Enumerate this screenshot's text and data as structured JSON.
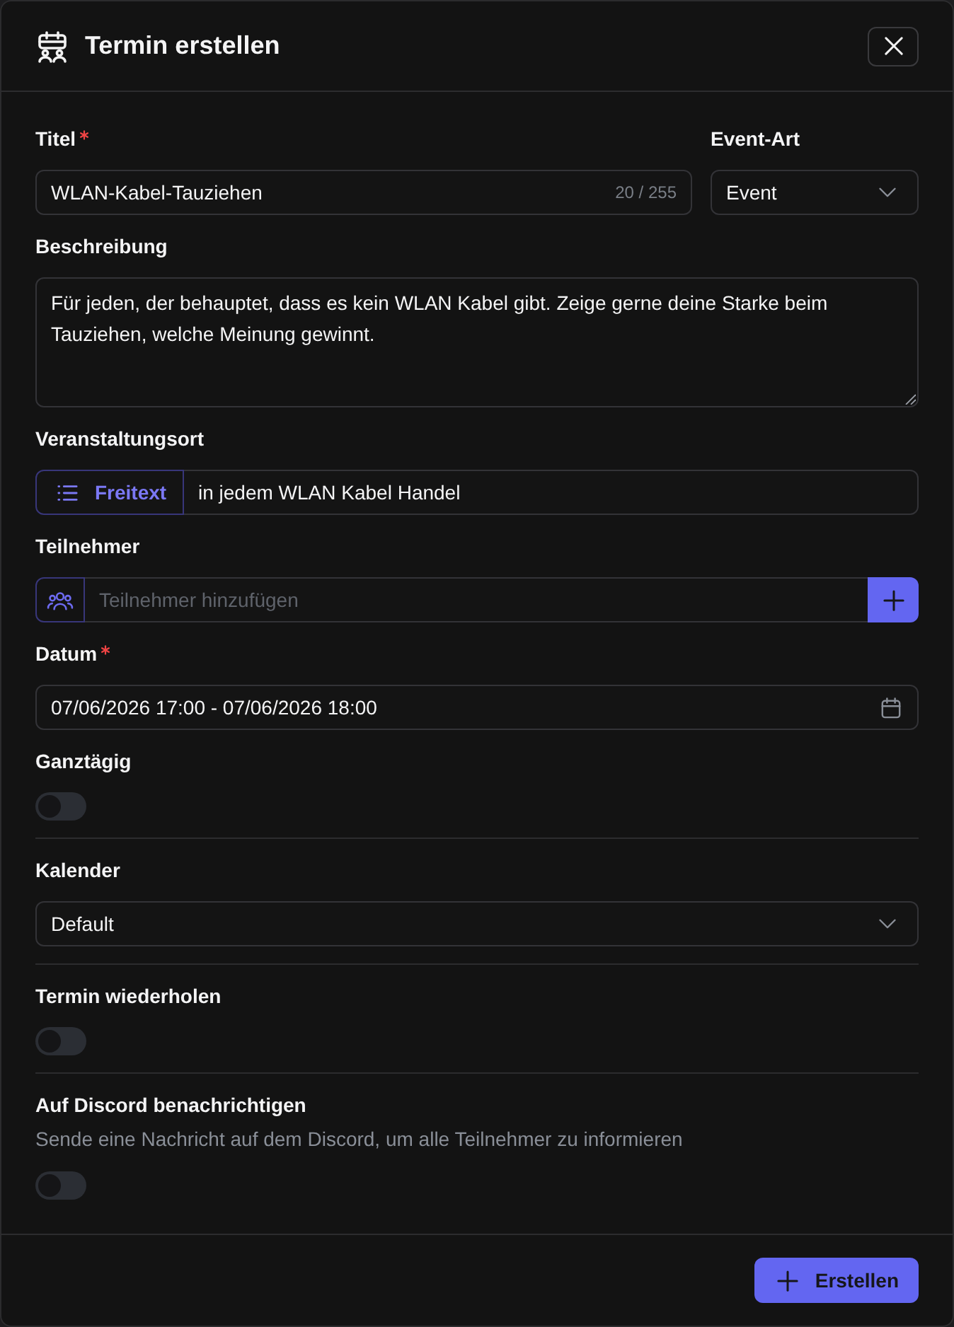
{
  "dialog": {
    "title": "Termin erstellen"
  },
  "title_field": {
    "label": "Titel",
    "required": true,
    "value": "WLAN-Kabel-Tauziehen",
    "counter": "20 / 255"
  },
  "event_type": {
    "label": "Event-Art",
    "value": "Event"
  },
  "description": {
    "label": "Beschreibung",
    "value": "Für jeden, der behauptet, dass es kein WLAN Kabel gibt. Zeige gerne deine Starke beim Tauziehen, welche Meinung gewinnt."
  },
  "location": {
    "label": "Veranstaltungsort",
    "mode": "Freitext",
    "value": "in jedem WLAN Kabel Handel"
  },
  "participants": {
    "label": "Teilnehmer",
    "placeholder": "Teilnehmer hinzufügen"
  },
  "date": {
    "label": "Datum",
    "required": true,
    "value": "07/06/2026 17:00 - 07/06/2026 18:00"
  },
  "all_day": {
    "label": "Ganztägig",
    "on": false
  },
  "calendar": {
    "label": "Kalender",
    "value": "Default"
  },
  "repeat": {
    "label": "Termin wiederholen",
    "on": false
  },
  "discord": {
    "label": "Auf Discord benachrichtigen",
    "hint": "Sende eine Nachricht auf dem Discord, um alle Teilnehmer zu informieren",
    "on": false
  },
  "footer": {
    "submit": "Erstellen"
  }
}
